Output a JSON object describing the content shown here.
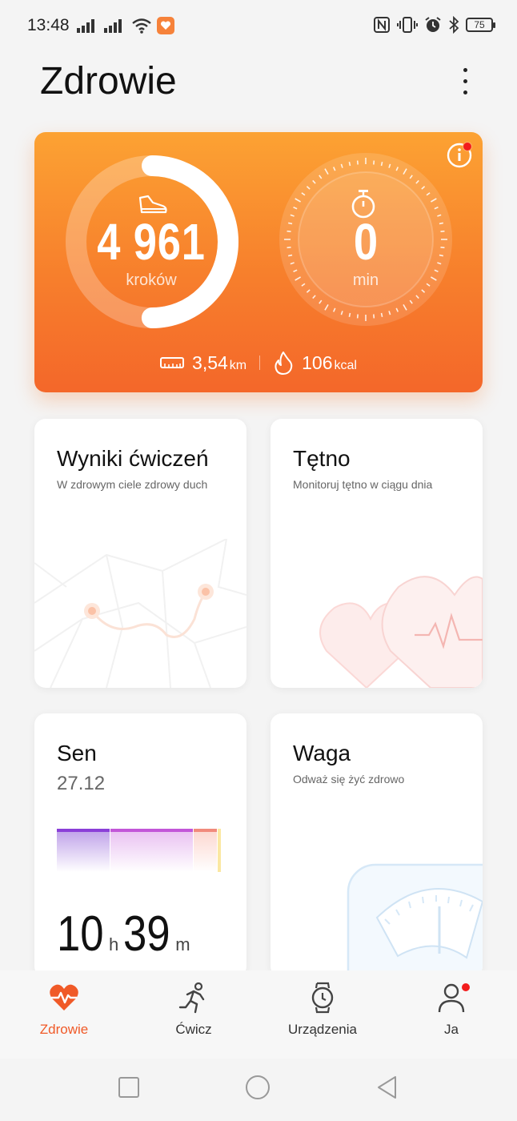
{
  "status_bar": {
    "time": "13:48",
    "battery_level": "75"
  },
  "header": {
    "title": "Zdrowie"
  },
  "activity": {
    "steps": "4 961",
    "steps_unit": "kroków",
    "steps_ring_progress": 0.5,
    "active_minutes": "0",
    "minutes_unit": "min",
    "distance": "3,54",
    "distance_unit": "km",
    "calories": "106",
    "calories_unit": "kcal"
  },
  "tiles": {
    "exercise": {
      "title": "Wyniki ćwiczeń",
      "subtitle": "W zdrowym ciele zdrowy duch"
    },
    "heart_rate": {
      "title": "Tętno",
      "subtitle": "Monitoruj tętno w ciągu dnia"
    },
    "sleep": {
      "title": "Sen",
      "date": "27.12",
      "hours": "10",
      "hours_unit": "h",
      "minutes": "39",
      "minutes_unit": "m"
    },
    "weight": {
      "title": "Waga",
      "subtitle": "Odważ się żyć zdrowo"
    }
  },
  "bottom_nav": {
    "items": [
      {
        "label": "Zdrowie",
        "icon": "heart-pulse-icon",
        "active": true
      },
      {
        "label": "Ćwicz",
        "icon": "runner-icon",
        "active": false
      },
      {
        "label": "Urządzenia",
        "icon": "watch-icon",
        "active": false
      },
      {
        "label": "Ja",
        "icon": "person-icon",
        "active": false,
        "badge": true
      }
    ]
  },
  "colors": {
    "accent": "#f05a28",
    "card_gradient_top": "#fca233",
    "card_gradient_bottom": "#f4672a",
    "badge": "#f21c1c"
  }
}
